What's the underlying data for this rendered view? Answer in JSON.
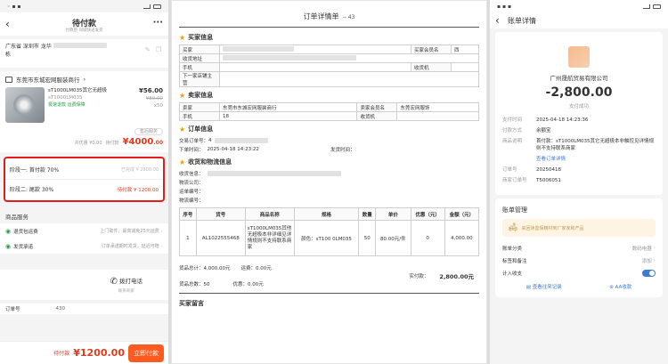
{
  "phone1": {
    "title": "待付款",
    "subtitle": "付款后 同城快递发货",
    "address": "广东省 深圳市 龙华",
    "address_line2": "栋",
    "shop_name": "东莞市东城宏网服装商行",
    "product": {
      "title": "sT1000LM035其它无超极",
      "spec": "sT1000LM035",
      "tags": "极速退款  运费保障",
      "price": "¥56.00",
      "orig_price": "¥80.00",
      "qty": "x50",
      "aftersale": "售后服务"
    },
    "total_prefix": "共优惠 ¥0.00",
    "total_label": "待付款",
    "total_amount": "¥4000",
    "total_decimals": ".00",
    "stages": [
      {
        "label": "阶段一: 首付款 70%",
        "status": "已完成 ¥ 2800.00"
      },
      {
        "label": "阶段二: 尾款 30%",
        "status": "待付款 ¥ 1200.00"
      }
    ],
    "service_title": "商品服务",
    "services": [
      {
        "name": "退货包运费",
        "desc": "上门取件，最高减免25元运费"
      },
      {
        "name": "发货承诺",
        "desc": "订单承诺期时发货，延迟可赔"
      }
    ],
    "call": {
      "label": "拨打电话",
      "sub": "联系商家"
    },
    "order_no_label": "订单号",
    "order_no": "430",
    "pay_label": "待付款",
    "pay_amount": "¥1200.00",
    "pay_button": "立即付款"
  },
  "doc": {
    "title": "订单详情单",
    "order_id": "-- 43",
    "buyer_section": "买家信息",
    "buyer_rows": [
      {
        "k1": "买家",
        "v1": "",
        "k2": "买家会员名",
        "v2": "西"
      },
      {
        "k1": "收货地址",
        "v1": "",
        "k2": "",
        "v2": ""
      },
      {
        "k1": "手机",
        "v1": "",
        "k2": "收货机",
        "v2": ""
      },
      {
        "k1": "下一家店铺主营",
        "v1": "",
        "k2": "",
        "v2": ""
      }
    ],
    "seller_section": "卖家信息",
    "seller_rows": [
      {
        "k1": "卖家",
        "v1": "东莞市东城宏网服装商行",
        "k2": "卖家会员名",
        "v2": "东莞宏网服饰"
      },
      {
        "k1": "手机",
        "v1": "18",
        "k2": "收货机",
        "v2": ""
      }
    ],
    "order_section": "订单信息",
    "order_no_label": "交易订单号：",
    "order_no_value": "4",
    "order_time_label": "下单时间：",
    "order_time": "2025-04-18 14:23:22",
    "ship_time_label": "发货时间：",
    "logistics_section": "收货和物流信息",
    "logistics_rows": [
      "收货信息：",
      "物流公司：",
      "运单编号：",
      "物流编号："
    ],
    "table_headers": [
      "序号",
      "货号",
      "商品名称",
      "规格",
      "数量",
      "单价",
      "优惠（元）",
      "金额（元）"
    ],
    "table_row": {
      "idx": "1",
      "sku": "AL1022555468",
      "name": "sT1000LM035其他无超极本非详细见详情规则不支持联系商家",
      "spec": "颜色：sT100 0LM035",
      "qty": "50",
      "unit": "80.00元/件",
      "discount": "0",
      "amount": "4,000.00"
    },
    "goods_total_label": "货品总计：",
    "goods_total": "4,000.00元",
    "shipping_label": "运费：",
    "shipping": "0.00元",
    "goods_count_label": "货品总数：",
    "goods_count": "50",
    "discount_label": "优惠：",
    "discount": "0.00元",
    "paid_label": "实付款：",
    "paid": "2,800.00元",
    "remark_section": "买家留言"
  },
  "phone3": {
    "title": "账单详情",
    "merchant": "广州晟航贸易有限公司",
    "amount": "-2,800.00",
    "status": "支付成功",
    "details": [
      {
        "k": "支付时间",
        "v": "2025-04-18 14:23:36"
      },
      {
        "k": "付款方式",
        "v": "余额宝"
      },
      {
        "k": "商品说明",
        "v": "首付款：sT1000LM035其它无超极本非触控见详情规则不支持联系商家"
      },
      {
        "k": "",
        "v": "查看订单详情"
      },
      {
        "k": "订单号",
        "v": "20250418"
      },
      {
        "k": "商家订单号",
        "v": "T5006051"
      }
    ],
    "mgmt_title": "账单管理",
    "banner": "来回读鉴保精材到厂家家和产品",
    "rows": [
      {
        "k": "账单分类",
        "v": "数码电器"
      },
      {
        "k": "标签和备注",
        "v": "添加"
      },
      {
        "k": "计入收支",
        "v": ""
      }
    ],
    "foot_left": "查看往来记录",
    "foot_right": "AA收款"
  }
}
